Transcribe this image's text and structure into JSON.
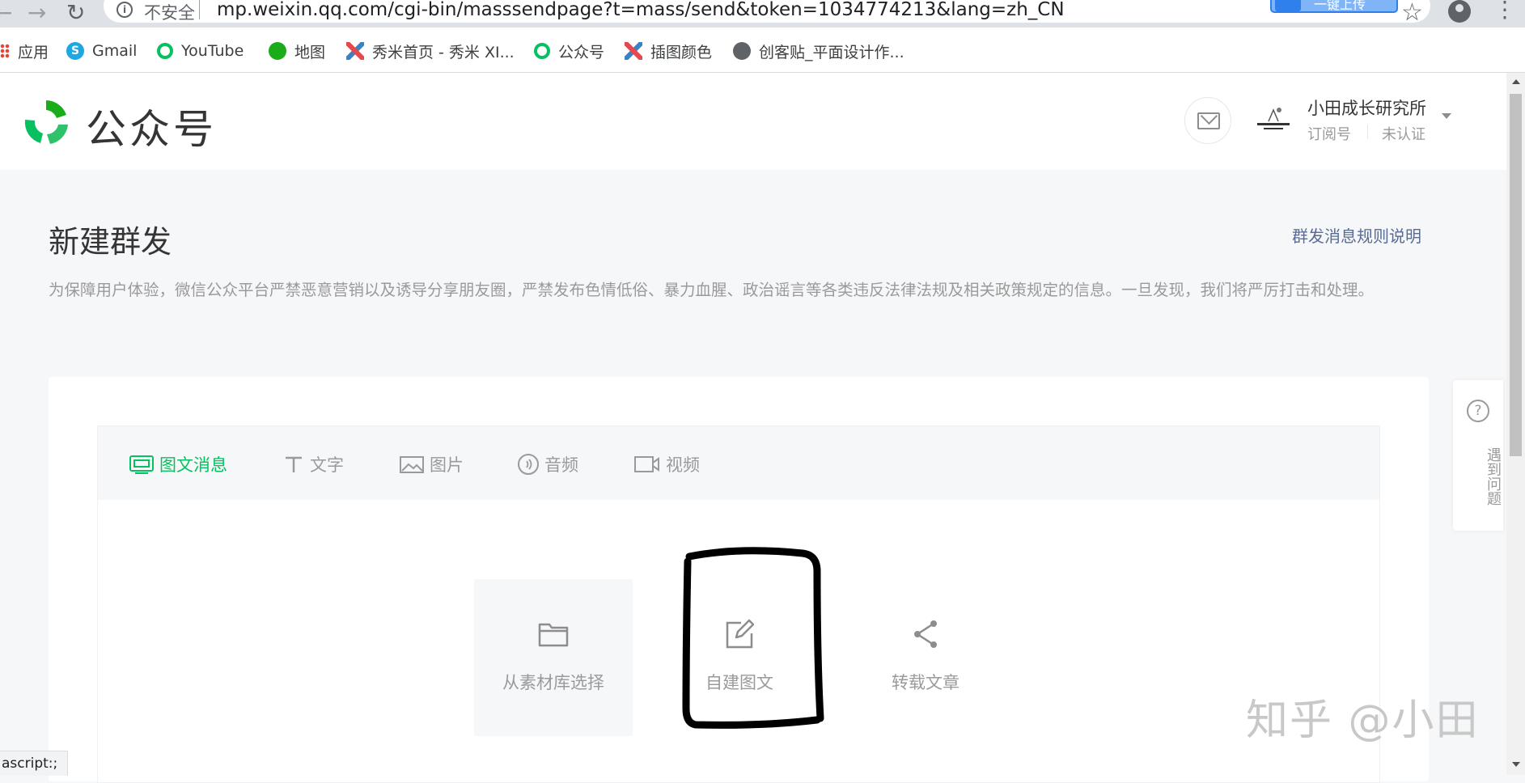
{
  "browser": {
    "insecure_label": "不安全",
    "url": "mp.weixin.qq.com/cgi-bin/masssendpage?t=mass/send&token=1034774213&lang=zh_CN",
    "extension_label": "一键上传",
    "status_bar_text": "ascript:;"
  },
  "bookmarks": [
    {
      "label": "应用",
      "icon": "apps-grid-icon"
    },
    {
      "label": "Gmail",
      "icon": "skype-icon",
      "color": "#1ea7e1"
    },
    {
      "label": "YouTube",
      "icon": "wechat-mp-icon",
      "color": "#07c160"
    },
    {
      "label": "地图",
      "icon": "wechat-icon",
      "color": "#1aad19"
    },
    {
      "label": "秀米首页 - 秀米 XI...",
      "icon": "xiumi-icon",
      "color": "#e5484d"
    },
    {
      "label": "公众号",
      "icon": "wechat-mp-icon",
      "color": "#07c160"
    },
    {
      "label": "插图颜色",
      "icon": "xiumi-icon",
      "color": "#e5484d"
    },
    {
      "label": "创客贴_平面设计作...",
      "icon": "globe-icon",
      "color": "#5f6368"
    }
  ],
  "header": {
    "logo_text": "公众号",
    "account_name": "小田成长研究所",
    "account_type": "订阅号",
    "account_verify": "未认证"
  },
  "page": {
    "title": "新建群发",
    "rules_link": "群发消息规则说明",
    "notice": "为保障用户体验，微信公众平台严禁恶意营销以及诱导分享朋友圈，严禁发布色情低俗、暴力血腥、政治谣言等各类违反法律法规及相关政策规定的信息。一旦发现，我们将严厉打击和处理。"
  },
  "tabs": [
    {
      "label": "图文消息",
      "icon": "news-icon",
      "active": true
    },
    {
      "label": "文字",
      "icon": "text-icon",
      "active": false
    },
    {
      "label": "图片",
      "icon": "image-icon",
      "active": false
    },
    {
      "label": "音频",
      "icon": "audio-icon",
      "active": false
    },
    {
      "label": "视频",
      "icon": "video-icon",
      "active": false
    }
  ],
  "options": [
    {
      "label": "从素材库选择",
      "icon": "folder-icon"
    },
    {
      "label": "自建图文",
      "icon": "edit-icon"
    },
    {
      "label": "转载文章",
      "icon": "share-icon"
    }
  ],
  "help": {
    "label": "遇到问题",
    "icon": "question-icon"
  },
  "watermark": "知乎 @小田",
  "colors": {
    "accent": "#07c160",
    "link": "#576b95",
    "muted": "#9a9a9a"
  }
}
